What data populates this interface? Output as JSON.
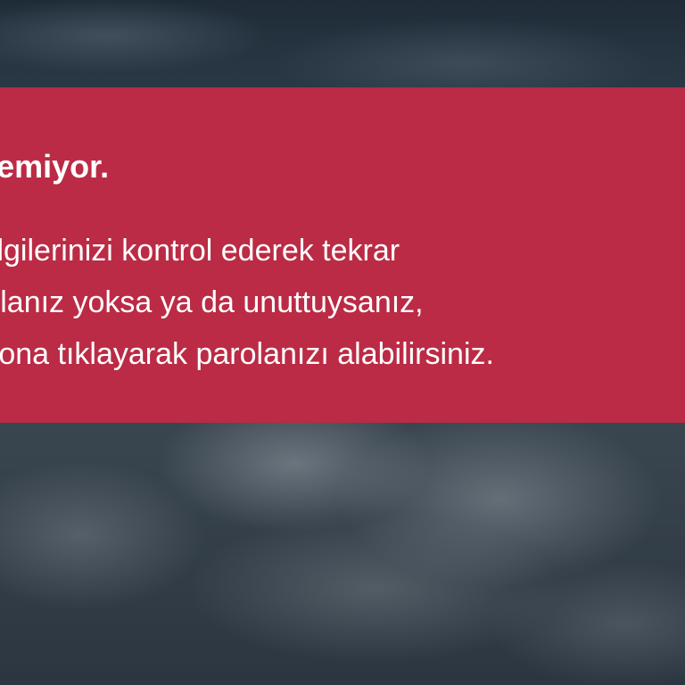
{
  "background": {
    "description": "cloudy-sky",
    "tint_color": "#2f3b46"
  },
  "dialog": {
    "color": "#bb2b45",
    "title": "devam edilemiyor.",
    "lines": [
      "bilgilerinizi kontrol ederek tekrar",
      "rolanız yoksa ya da unuttuysanız,",
      "utona tıklayarak parolanızı alabilirsiniz."
    ]
  }
}
